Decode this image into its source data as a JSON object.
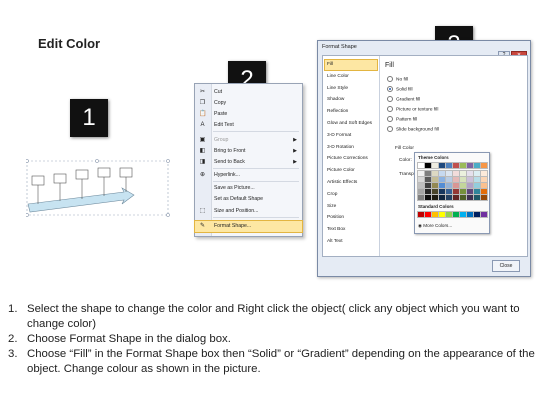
{
  "title": "Edit Color",
  "callouts": {
    "one": "1",
    "two": "2",
    "three": "3"
  },
  "context_menu": {
    "items": [
      {
        "label": "Cut",
        "icon": "scissors-icon",
        "glyph": "✂",
        "disabled": false
      },
      {
        "label": "Copy",
        "icon": "copy-icon",
        "glyph": "❐",
        "disabled": false
      },
      {
        "label": "Paste",
        "icon": "paste-icon",
        "glyph": "📋",
        "disabled": false
      },
      {
        "label": "Edit Text",
        "icon": "edit-text-icon",
        "glyph": "A",
        "disabled": false
      },
      {
        "label": "Group",
        "icon": "group-icon",
        "glyph": "▣",
        "disabled": true,
        "submenu": true
      },
      {
        "label": "Bring to Front",
        "icon": "bring-front-icon",
        "glyph": "◧",
        "disabled": false,
        "submenu": true
      },
      {
        "label": "Send to Back",
        "icon": "send-back-icon",
        "glyph": "◨",
        "disabled": false,
        "submenu": true
      },
      {
        "label": "Hyperlink...",
        "icon": "hyperlink-icon",
        "glyph": "⊕",
        "disabled": false
      },
      {
        "label": "Save as Picture...",
        "icon": "",
        "glyph": "",
        "disabled": false
      },
      {
        "label": "Set as Default Shape",
        "icon": "",
        "glyph": "",
        "disabled": false
      },
      {
        "label": "Size and Position...",
        "icon": "size-position-icon",
        "glyph": "⬚",
        "disabled": false
      },
      {
        "label": "Format Shape...",
        "icon": "format-shape-icon",
        "glyph": "✎",
        "disabled": false,
        "highlighted": true
      }
    ]
  },
  "dialog": {
    "title": "Format Shape",
    "nav": [
      "Fill",
      "Line Color",
      "Line Style",
      "Shadow",
      "Reflection",
      "Glow and Soft Edges",
      "3-D Format",
      "3-D Rotation",
      "Picture Corrections",
      "Picture Color",
      "Artistic Effects",
      "Crop",
      "Size",
      "Position",
      "Text Box",
      "Alt Text"
    ],
    "selected_nav": "Fill",
    "pane_title": "Fill",
    "fill_options": [
      {
        "label": "No fill",
        "selected": false
      },
      {
        "label": "Solid fill",
        "selected": true
      },
      {
        "label": "Gradient fill",
        "selected": false
      },
      {
        "label": "Picture or texture fill",
        "selected": false
      },
      {
        "label": "Pattern fill",
        "selected": false
      },
      {
        "label": "Slide background fill",
        "selected": false
      }
    ],
    "fill_color_label": "Fill Color",
    "color_label": "Color:",
    "transparency_label": "Transpa",
    "close_label": "Close"
  },
  "palette": {
    "theme_label": "Theme Colors",
    "standard_label": "Standard Colors",
    "more_label": "More Colors...",
    "theme_top": [
      "#ffffff",
      "#000000",
      "#eeece1",
      "#1f497d",
      "#4f81bd",
      "#c0504d",
      "#9bbb59",
      "#8064a2",
      "#4bacc6",
      "#f79646"
    ],
    "theme_shades": [
      [
        "#f2f2f2",
        "#7f7f7f",
        "#ddd9c3",
        "#c6d9f0",
        "#dbe5f1",
        "#f2dcdb",
        "#ebf1dd",
        "#e5e0ec",
        "#dbeef3",
        "#fdeada"
      ],
      [
        "#d8d8d8",
        "#595959",
        "#c4bd97",
        "#8db3e2",
        "#b8cce4",
        "#e5b9b7",
        "#d7e3bc",
        "#ccc1d9",
        "#b7dde8",
        "#fbd5b5"
      ],
      [
        "#bfbfbf",
        "#3f3f3f",
        "#938953",
        "#548dd4",
        "#95b3d7",
        "#d99694",
        "#c3d69b",
        "#b2a2c7",
        "#92cddc",
        "#fac08f"
      ],
      [
        "#a5a5a5",
        "#262626",
        "#494429",
        "#17365d",
        "#366092",
        "#953734",
        "#76923c",
        "#5f497a",
        "#31859b",
        "#e36c09"
      ],
      [
        "#7f7f7f",
        "#0c0c0c",
        "#1d1b10",
        "#0f243e",
        "#244061",
        "#632423",
        "#4f6128",
        "#3f3151",
        "#205867",
        "#974806"
      ]
    ],
    "standard": [
      "#c00000",
      "#ff0000",
      "#ffc000",
      "#ffff00",
      "#92d050",
      "#00b050",
      "#00b0f0",
      "#0070c0",
      "#002060",
      "#7030a0"
    ]
  },
  "instructions": [
    {
      "num": "1.",
      "text": "Select the shape to change the color and Right click the object( click any object which you want to change color)"
    },
    {
      "num": "2.",
      "text": "Choose Format Shape in the dialog box."
    },
    {
      "num": "3.",
      "text": "Choose “Fill” in the Format Shape box then “Solid” or “Gradient” depending on the appearance of the object. Change colour as shown in the picture."
    }
  ]
}
